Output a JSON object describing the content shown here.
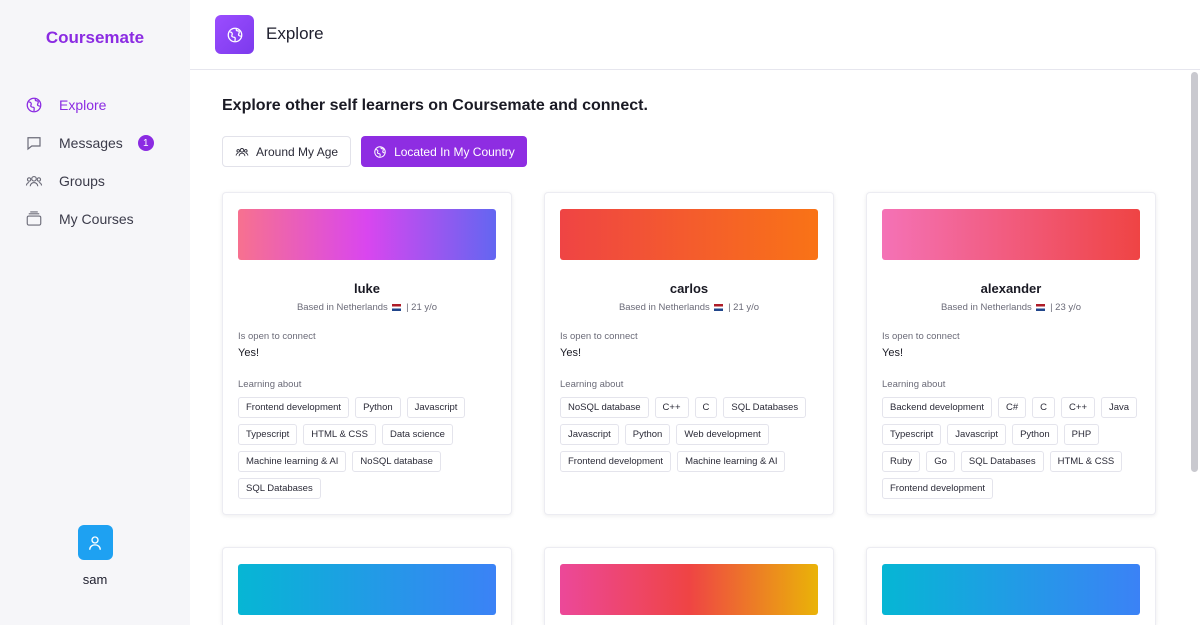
{
  "app": {
    "brand": "Coursemate"
  },
  "sidebar": {
    "items": [
      {
        "label": "Explore",
        "icon": "globe-icon",
        "active": true
      },
      {
        "label": "Messages",
        "icon": "chat-icon",
        "badge": "1"
      },
      {
        "label": "Groups",
        "icon": "users-icon"
      },
      {
        "label": "My Courses",
        "icon": "book-icon"
      }
    ],
    "user": {
      "name": "sam",
      "icon": "user-icon"
    }
  },
  "header": {
    "title": "Explore",
    "icon": "globe-icon"
  },
  "main": {
    "headline": "Explore other self learners on Coursemate and connect.",
    "filters": [
      {
        "label": "Around My Age",
        "icon": "users-icon"
      },
      {
        "label": "Located In My Country",
        "icon": "globe-icon",
        "active": true
      }
    ],
    "cards": [
      {
        "name": "luke",
        "based_prefix": "Based in Netherlands",
        "age": "| 21 y/o",
        "open_label": "Is open to connect",
        "open_value": "Yes!",
        "learning_label": "Learning about",
        "tags": [
          "Frontend development",
          "Python",
          "Javascript",
          "Typescript",
          "HTML & CSS",
          "Data science",
          "Machine learning & AI",
          "NoSQL database",
          "SQL Databases"
        ]
      },
      {
        "name": "carlos",
        "based_prefix": "Based in Netherlands",
        "age": "| 21 y/o",
        "open_label": "Is open to connect",
        "open_value": "Yes!",
        "learning_label": "Learning about",
        "tags": [
          "NoSQL database",
          "C++",
          "C",
          "SQL Databases",
          "Javascript",
          "Python",
          "Web development",
          "Frontend development",
          "Machine learning & AI"
        ]
      },
      {
        "name": "alexander",
        "based_prefix": "Based in Netherlands",
        "age": "| 23 y/o",
        "open_label": "Is open to connect",
        "open_value": "Yes!",
        "learning_label": "Learning about",
        "tags": [
          "Backend development",
          "C#",
          "C",
          "C++",
          "Java",
          "Typescript",
          "Javascript",
          "Python",
          "PHP",
          "Ruby",
          "Go",
          "SQL Databases",
          "HTML & CSS",
          "Frontend development"
        ]
      }
    ]
  },
  "colors": {
    "accent": "#8b2be2",
    "banners": [
      [
        "#f7718f",
        "#d946ef",
        "#6366f1"
      ],
      [
        "#ef4444",
        "#f97316"
      ],
      [
        "#f472b6",
        "#ef4444"
      ],
      [
        "#06b6d4",
        "#3b82f6"
      ],
      [
        "#ec4899",
        "#ef4444",
        "#eab308"
      ],
      [
        "#06b6d4",
        "#3b82f6"
      ]
    ]
  }
}
